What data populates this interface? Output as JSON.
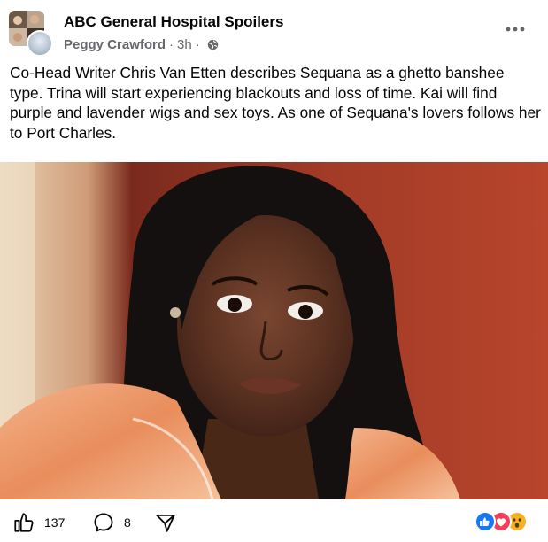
{
  "post": {
    "group_name": "ABC General Hospital Spoilers",
    "author": "Peggy Crawford",
    "separator": "·",
    "time": "3h",
    "privacy_icon": "globe-icon",
    "more_icon": "more-horizontal-icon",
    "text": "Co-Head Writer Chris Van Etten describes Sequana as a ghetto banshee type. Trina will start experiencing blackouts and loss of time. Kai will find purple and lavender wigs and sex toys. As one of Sequana's lovers follows her to Port Charles.",
    "image_icon": "post-photo"
  },
  "footer": {
    "like_count": "137",
    "comment_count": "8",
    "like_icon": "thumbs-up-icon",
    "comment_icon": "comment-icon",
    "share_icon": "share-icon",
    "reactions": [
      "like-reaction-icon",
      "love-reaction-icon",
      "wow-reaction-icon"
    ]
  },
  "colors": {
    "text": "#050505",
    "secondary": "#65676b",
    "like_blue": "#1877f2",
    "love_red": "#f33e58",
    "wow_yellow": "#f7b125"
  }
}
